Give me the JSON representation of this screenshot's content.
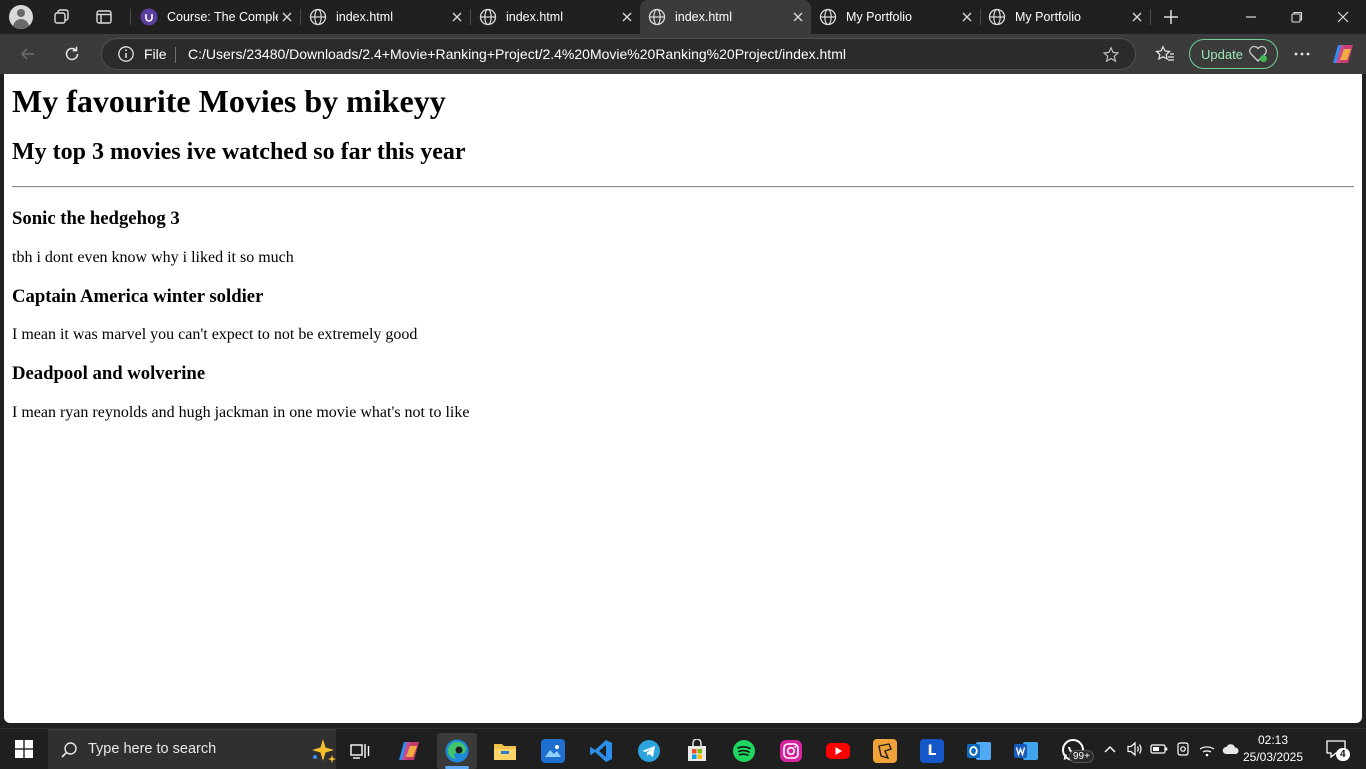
{
  "browser": {
    "tabs": [
      {
        "title": "Course: The Complet",
        "icon": "udemy-icon",
        "active": false
      },
      {
        "title": "index.html",
        "icon": "globe-icon",
        "active": false
      },
      {
        "title": "index.html",
        "icon": "globe-icon",
        "active": false
      },
      {
        "title": "index.html",
        "icon": "globe-icon",
        "active": true
      },
      {
        "title": "My Portfolio",
        "icon": "globe-icon",
        "active": false
      },
      {
        "title": "My Portfolio",
        "icon": "globe-icon",
        "active": false
      }
    ],
    "address": {
      "scheme_label": "File",
      "url": "C:/Users/23480/Downloads/2.4+Movie+Ranking+Project/2.4%20Movie%20Ranking%20Project/index.html"
    },
    "update_label": "Update",
    "accent_color": "#6fcf97"
  },
  "page": {
    "heading": "My favourite Movies by mikeyy",
    "subheading": "My top 3 movies ive watched so far this year",
    "movies": [
      {
        "title": "Sonic the hedgehog 3",
        "comment": "tbh i dont even know why i liked it so much"
      },
      {
        "title": "Captain America winter soldier",
        "comment": "I mean it was marvel you can't expect to not be extremely good"
      },
      {
        "title": "Deadpool and wolverine",
        "comment": "I mean ryan reynolds and hugh jackman in one movie what's not to like"
      }
    ]
  },
  "taskbar": {
    "search_placeholder": "Type here to search",
    "whatsapp_badge": "99+",
    "clock_time": "02:13",
    "clock_date": "25/03/2025",
    "notification_count": "4"
  }
}
